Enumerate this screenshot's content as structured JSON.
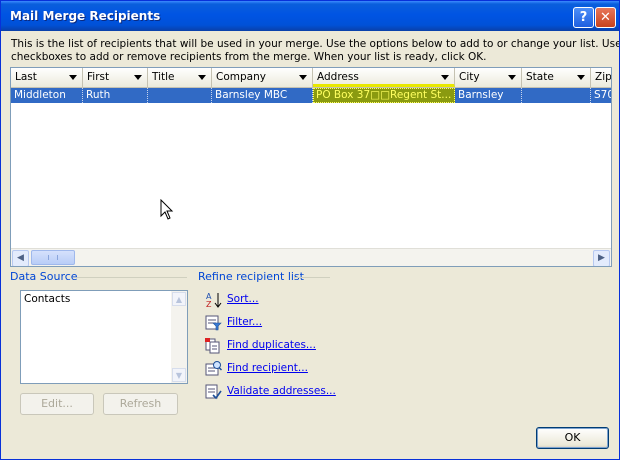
{
  "window": {
    "title": "Mail Merge Recipients",
    "help_label": "?",
    "close_label": "✕"
  },
  "intro": {
    "line1": "This is the list of recipients that will be used in your merge.  Use the options below to add to or change your list.  Use the",
    "line2": "checkboxes to add or remove recipients from the merge.  When your list is ready, click OK."
  },
  "grid": {
    "columns": [
      "Last",
      "First",
      "Title",
      "Company",
      "Address",
      "City",
      "State",
      "Zip"
    ],
    "rows": [
      {
        "last": "Middleton",
        "first": "Ruth",
        "title": "",
        "company": "Barnsley MBC",
        "address": "PO Box 37□□Regent St...",
        "city": "Barnsley",
        "state": "",
        "zip": "S70"
      }
    ]
  },
  "scroll": {
    "left_arrow": "◀",
    "right_arrow": "▶",
    "up_arrow": "▲",
    "down_arrow": "▼"
  },
  "data_source": {
    "title": "Data Source",
    "items": [
      "Contacts"
    ],
    "edit_label": "Edit...",
    "refresh_label": "Refresh"
  },
  "refine": {
    "title": "Refine recipient list",
    "links": [
      {
        "label": "Sort...",
        "icon": "sort-az-icon"
      },
      {
        "label": "Filter...",
        "icon": "filter-icon"
      },
      {
        "label": "Find duplicates...",
        "icon": "find-duplicates-icon"
      },
      {
        "label": "Find recipient...",
        "icon": "find-recipient-icon"
      },
      {
        "label": "Validate addresses...",
        "icon": "validate-addresses-icon"
      }
    ]
  },
  "ok_label": "OK",
  "colors": {
    "title_bar": "#0054e3",
    "selection": "#316ac5",
    "address_highlight": "#e8e800",
    "link": "#0000ee",
    "dialog_bg": "#ece9d8"
  }
}
